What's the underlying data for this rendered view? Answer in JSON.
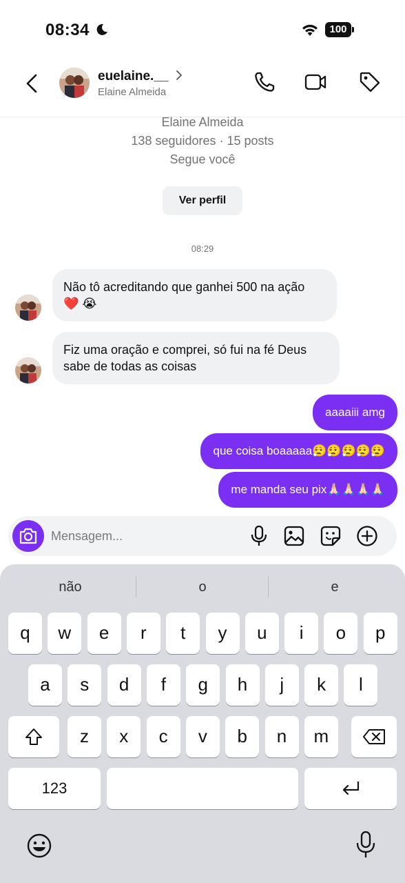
{
  "status_bar": {
    "time": "08:34",
    "battery": "100"
  },
  "header": {
    "username": "euelaine.__",
    "full_name": "Elaine Almeida"
  },
  "profile": {
    "name": "Elaine Almeida",
    "stats": "138 seguidores · 15 posts",
    "follow_status": "Segue você",
    "view_profile_label": "Ver perfil"
  },
  "thread": {
    "timestamp": "08:29",
    "incoming": [
      {
        "line1": "Não tô acreditando que ganhei 500 na ação",
        "line2": "❤️ 😭"
      },
      {
        "line1": "Fiz uma oração e comprei,  só fui na fé Deus",
        "line2": "sabe de todas as coisas"
      }
    ],
    "outgoing": [
      "aaaaiii amg",
      "que coisa boaaaaa😮‍💨😮‍💨😮‍💨😮‍💨😮‍💨",
      "me manda seu pix🙏🏻🙏🏻🙏🏻🙏🏻"
    ]
  },
  "composer": {
    "placeholder": "Mensagem..."
  },
  "keyboard": {
    "suggestions": [
      "não",
      "o",
      "e"
    ],
    "row1": [
      "q",
      "w",
      "e",
      "r",
      "t",
      "y",
      "u",
      "i",
      "o",
      "p"
    ],
    "row2": [
      "a",
      "s",
      "d",
      "f",
      "g",
      "h",
      "j",
      "k",
      "l"
    ],
    "row3": [
      "z",
      "x",
      "c",
      "v",
      "b",
      "n",
      "m"
    ],
    "numbers_label": "123"
  },
  "colors": {
    "accent": "#7b2ff2",
    "incoming_bubble": "#eff1f3",
    "keyboard_bg": "#d9dbe0"
  },
  "icons": [
    "moon-icon",
    "wifi-icon",
    "back-chevron-icon",
    "phone-icon",
    "video-icon",
    "tag-icon",
    "camera-icon",
    "microphone-icon",
    "gallery-icon",
    "sticker-icon",
    "plus-icon",
    "shift-icon",
    "backspace-icon",
    "return-icon",
    "emoji-icon",
    "dictation-icon"
  ]
}
